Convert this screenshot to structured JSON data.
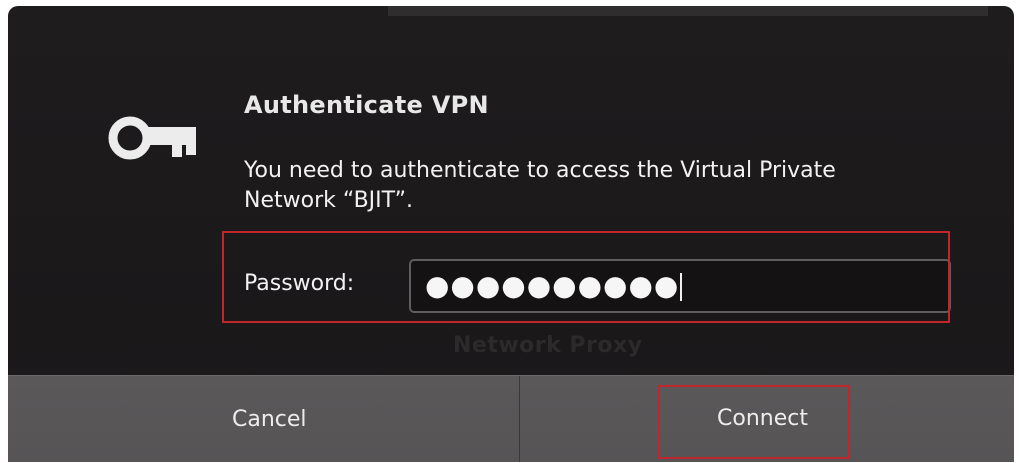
{
  "dialog": {
    "title": "Authenticate VPN",
    "message": "You need to authenticate to access the Virtual Private Network “BJIT”.",
    "icon": "key-icon",
    "background_text": "Network Proxy"
  },
  "password": {
    "label": "Password:",
    "masked_value": "●●●●●●●●●●"
  },
  "buttons": {
    "cancel_label": "Cancel",
    "connect_label": "Connect"
  },
  "colors": {
    "dialog_bg": "#1c1a1b",
    "button_bar_bg": "#585657",
    "highlight": "#c0262b",
    "text": "#f2f2f2"
  }
}
